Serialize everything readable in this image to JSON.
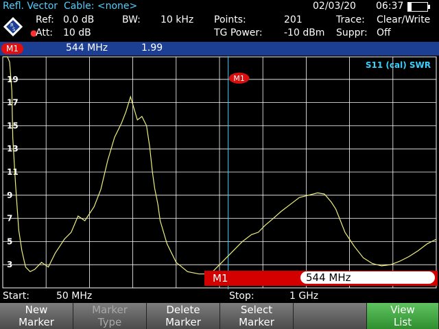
{
  "header": {
    "mode": "Refl. Vector",
    "cable": "Cable: <none>",
    "date": "02/03/20",
    "time": "06:37"
  },
  "settings": {
    "ref_label": "Ref:",
    "ref_value": "0.0 dB",
    "att_label": "Att:",
    "att_value": "10 dB",
    "bw_label": "BW:",
    "bw_value": "10 kHz",
    "points_label": "Points:",
    "points_value": "201",
    "tg_label": "TG Power:",
    "tg_value": "-10 dBm",
    "trace_label": "Trace:",
    "trace_value": "Clear/Write",
    "suppr_label": "Suppr:",
    "suppr_value": "Off"
  },
  "marker_bar": {
    "tag": "M1",
    "freq": "544  MHz",
    "value": "1.99"
  },
  "plot": {
    "trace_label": "S11 (cal) SWR",
    "marker_label": "M1",
    "trace_color": "#f0f080",
    "y_ticks": [
      "19",
      "17",
      "15",
      "13",
      "11",
      "9",
      "7",
      "5",
      "3"
    ]
  },
  "chart_data": {
    "type": "line",
    "ylim": [
      1,
      21
    ],
    "xlim": [
      50,
      1000
    ],
    "grid": true,
    "series": [
      {
        "x": [
          50,
          60,
          65,
          70,
          72,
          78,
          85,
          92,
          100,
          110,
          120,
          135,
          150,
          165,
          175,
          185,
          200,
          215,
          230,
          250,
          265,
          280,
          295,
          310,
          320,
          330,
          345,
          355,
          365,
          372,
          378,
          383,
          390,
          395,
          410,
          430,
          455,
          480,
          505,
          520,
          540,
          555,
          575,
          595,
          610,
          625,
          640,
          660,
          680,
          700,
          720,
          740,
          755,
          770,
          780,
          790,
          800,
          820,
          840,
          860,
          880,
          900,
          920,
          940,
          960,
          980,
          1000
        ],
        "y": [
          21,
          21,
          20.5,
          18,
          14,
          10,
          6,
          4.2,
          2.8,
          2.4,
          2.6,
          3.2,
          2.8,
          4,
          4.6,
          5.2,
          5.8,
          7.2,
          6.8,
          8,
          9.5,
          12,
          14,
          15.2,
          16.2,
          17.5,
          15.5,
          15.8,
          15,
          13.2,
          11,
          9.6,
          8.2,
          6.8,
          4.8,
          3.2,
          2.4,
          2.2,
          2.2,
          2.8,
          3.6,
          4.2,
          5,
          5.6,
          5.8,
          6.4,
          6.9,
          7.6,
          8.2,
          8.8,
          9,
          9.2,
          9.1,
          8.4,
          7.8,
          6.8,
          5.8,
          4.6,
          3.6,
          3.1,
          2.9,
          3,
          3.3,
          3.7,
          4.2,
          4.8,
          5.2
        ]
      }
    ],
    "marker": {
      "x": 544,
      "y": 1.99
    }
  },
  "readout": {
    "label": "M1",
    "value": "544 MHz"
  },
  "span": {
    "start_label": "Start:",
    "start_value": "50 MHz",
    "stop_label": "Stop:",
    "stop_value": "1 GHz"
  },
  "softkeys": [
    {
      "line1": "New",
      "line2": "Marker"
    },
    {
      "line1": "Marker",
      "line2": "Type"
    },
    {
      "line1": "Delete",
      "line2": "Marker"
    },
    {
      "line1": "Select",
      "line2": "Marker"
    },
    {
      "line1": "",
      "line2": ""
    },
    {
      "line1": "View",
      "line2": "List"
    }
  ]
}
